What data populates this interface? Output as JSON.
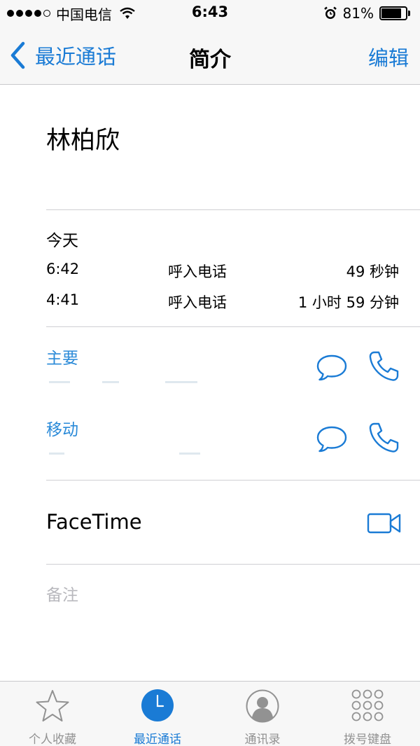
{
  "status_bar": {
    "carrier": "中国电信",
    "time": "6:43",
    "battery": "81%",
    "battery_level": 0.81,
    "signal_bars_filled": 4,
    "signal_bars_total": 5
  },
  "nav": {
    "back_label": "最近通话",
    "title": "简介",
    "edit_label": "编辑"
  },
  "contact": {
    "name": "林柏欣"
  },
  "recent": {
    "date": "今天",
    "calls": [
      {
        "time": "6:42",
        "type": "呼入电话",
        "duration": "49 秒钟"
      },
      {
        "time": "4:41",
        "type": "呼入电话",
        "duration": "1 小时 59 分钟"
      }
    ]
  },
  "phones": [
    {
      "label": "主要"
    },
    {
      "label": "移动"
    }
  ],
  "facetime": {
    "label": "FaceTime"
  },
  "notes": {
    "placeholder": "备注"
  },
  "tabs": [
    {
      "label": "个人收藏",
      "icon": "star-icon",
      "active": false
    },
    {
      "label": "最近通话",
      "icon": "clock-icon",
      "active": true
    },
    {
      "label": "通讯录",
      "icon": "contacts-icon",
      "active": false
    },
    {
      "label": "拨号键盘",
      "icon": "keypad-icon",
      "active": false
    }
  ],
  "colors": {
    "accent": "#1a7bd5",
    "phone_label": "#2a8ad8",
    "tab_inactive": "#929292",
    "notes_placeholder": "#b8b8bd"
  }
}
